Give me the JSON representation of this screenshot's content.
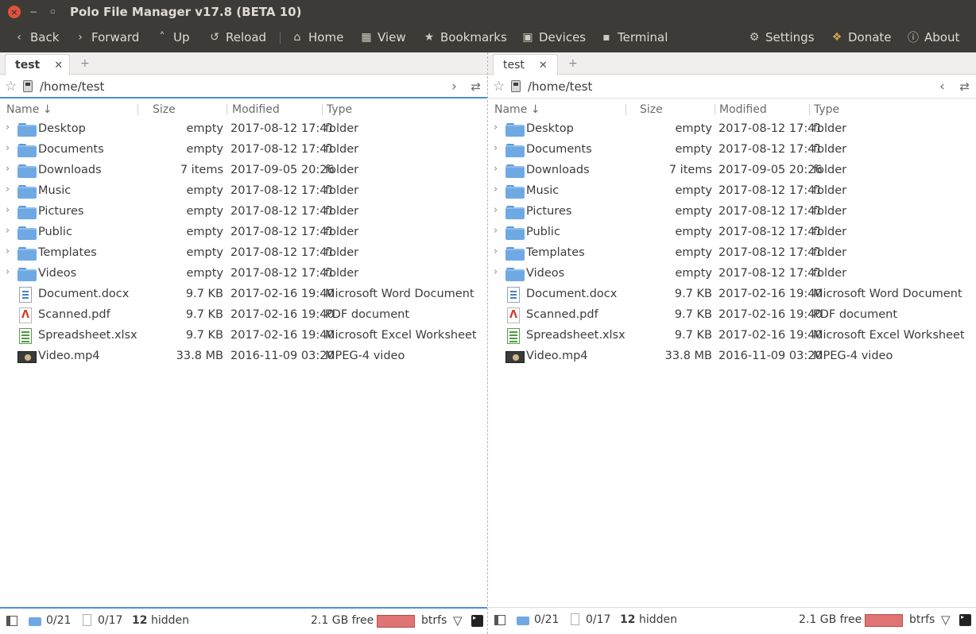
{
  "window": {
    "title": "Polo File Manager v17.8 (BETA 10)",
    "close_glyph": "×",
    "min_glyph": "−",
    "max_glyph": "▫"
  },
  "toolbar": {
    "back": "Back",
    "forward": "Forward",
    "up": "Up",
    "reload": "Reload",
    "home": "Home",
    "view": "View",
    "bookmarks": "Bookmarks",
    "devices": "Devices",
    "terminal": "Terminal",
    "settings": "Settings",
    "donate": "Donate",
    "about": "About"
  },
  "columns": {
    "name": "Name ↓",
    "size": "Size",
    "modified": "Modified",
    "type": "Type"
  },
  "panes": [
    {
      "tab_label": "test",
      "path": "/home/test",
      "nav_arrow": "›",
      "status": {
        "dirs": "0/21",
        "files": "0/17",
        "hidden_count": "12",
        "hidden_label": "hidden",
        "free": "2.1 GB  free",
        "fs": "btrfs"
      }
    },
    {
      "tab_label": "test",
      "path": "/home/test",
      "nav_arrow": "‹",
      "status": {
        "dirs": "0/21",
        "files": "0/17",
        "hidden_count": "12",
        "hidden_label": "hidden",
        "free": "2.1 GB  free",
        "fs": "btrfs"
      }
    }
  ],
  "files": [
    {
      "name": "Desktop",
      "size": "empty",
      "modified": "2017-08-12 17:41",
      "type": "folder",
      "icon": "folder-icon"
    },
    {
      "name": "Documents",
      "size": "empty",
      "modified": "2017-08-12 17:41",
      "type": "folder",
      "icon": "folder-icon"
    },
    {
      "name": "Downloads",
      "size": "7 items",
      "modified": "2017-09-05 20:26",
      "type": "folder",
      "icon": "folder-icon"
    },
    {
      "name": "Music",
      "size": "empty",
      "modified": "2017-08-12 17:41",
      "type": "folder",
      "icon": "folder-icon"
    },
    {
      "name": "Pictures",
      "size": "empty",
      "modified": "2017-08-12 17:41",
      "type": "folder",
      "icon": "folder-icon"
    },
    {
      "name": "Public",
      "size": "empty",
      "modified": "2017-08-12 17:41",
      "type": "folder",
      "icon": "folder-icon"
    },
    {
      "name": "Templates",
      "size": "empty",
      "modified": "2017-08-12 17:41",
      "type": "folder",
      "icon": "folder-icon"
    },
    {
      "name": "Videos",
      "size": "empty",
      "modified": "2017-08-12 17:41",
      "type": "folder",
      "icon": "folder-icon"
    },
    {
      "name": "Document.docx",
      "size": "9.7 KB",
      "modified": "2017-02-16 19:40",
      "type": "Microsoft Word Document",
      "icon": "word-document-icon"
    },
    {
      "name": "Scanned.pdf",
      "size": "9.7 KB",
      "modified": "2017-02-16 19:40",
      "type": "PDF document",
      "icon": "pdf-icon"
    },
    {
      "name": "Spreadsheet.xlsx",
      "size": "9.7 KB",
      "modified": "2017-02-16 19:40",
      "type": "Microsoft Excel Worksheet",
      "icon": "spreadsheet-icon"
    },
    {
      "name": "Video.mp4",
      "size": "33.8 MB",
      "modified": "2016-11-09 03:20",
      "type": "MPEG-4 video",
      "icon": "video-icon"
    }
  ],
  "colors": {
    "chrome_bg": "#3c3b37",
    "accent": "#4a90d9",
    "folder": "#6ea9e4",
    "disk_usage": "#e07373"
  }
}
